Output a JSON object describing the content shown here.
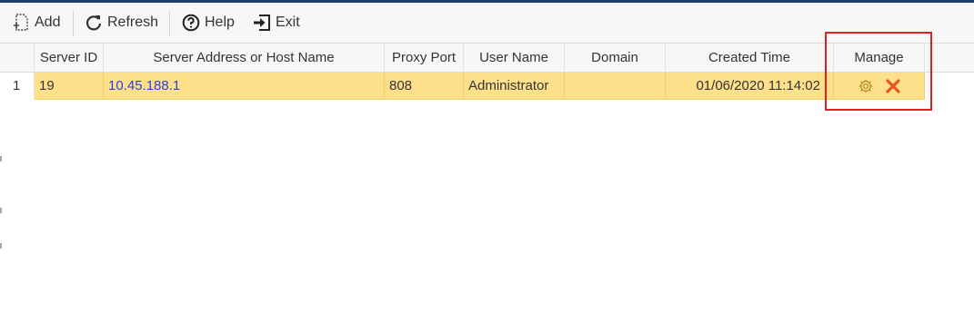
{
  "toolbar": {
    "add_label": "Add",
    "refresh_label": "Refresh",
    "help_label": "Help",
    "exit_label": "Exit"
  },
  "table": {
    "columns": [
      "Server ID",
      "Server Address or Host Name",
      "Proxy Port",
      "User Name",
      "Domain",
      "Created Time",
      "Manage"
    ],
    "rows": [
      {
        "row_number": "1",
        "server_id": "19",
        "server_address": "10.45.188.1",
        "proxy_port": "808",
        "user_name": "Administrator",
        "domain": "",
        "created_time": "01/06/2020 11:14:02",
        "manage_icons": [
          "gear-icon",
          "delete-x-icon"
        ]
      }
    ]
  },
  "colors": {
    "selected_row": "#ffe08a",
    "link": "#2b3fe6",
    "highlight_box": "#e02020",
    "delete_icon": "#e8541c",
    "gear_icon": "#b8902a"
  }
}
